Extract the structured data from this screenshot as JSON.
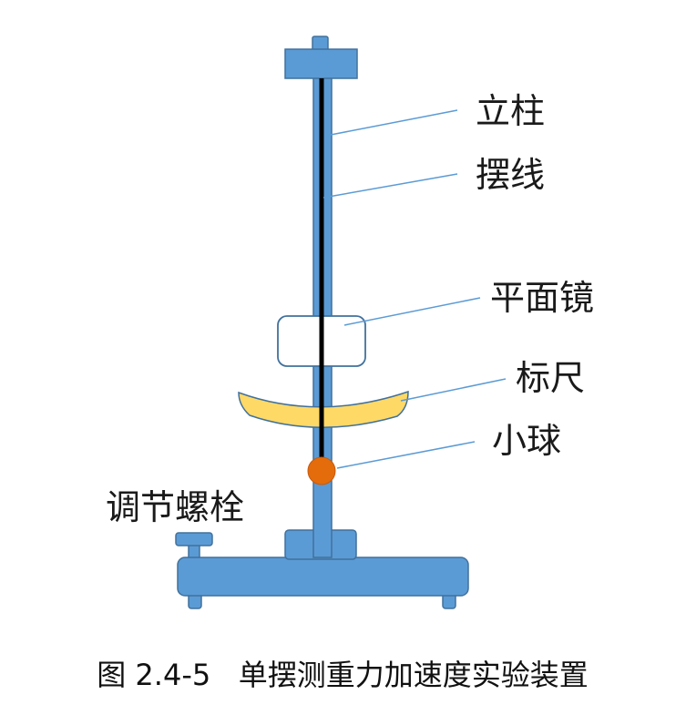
{
  "figure": {
    "caption": "图 2.4-5   单摆测重力加速度实验装置",
    "labels": {
      "column": "立柱",
      "string": "摆线",
      "mirror": "平面镜",
      "scale": "标尺",
      "ball": "小球",
      "screw": "调节螺栓"
    }
  },
  "colors": {
    "frame": "#5b9bd5",
    "frame_stroke": "#41719c",
    "string": "#000000",
    "ball": "#e46c0a",
    "scale": "#ffd966",
    "leader": "#5b9bd5"
  }
}
